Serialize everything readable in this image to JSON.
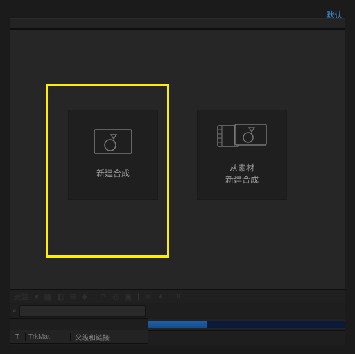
{
  "top": {
    "link_label": "默认"
  },
  "panel": {
    "tiles": [
      {
        "label": "新建合成",
        "icon": "composition-icon"
      },
      {
        "label": "从素材\n新建合成",
        "icon": "media-composition-icon"
      }
    ]
  },
  "toolbar": {
    "quality_label": "完整",
    "percent": "~00"
  },
  "timeline": {
    "col_t": "T",
    "col_trkmat": "TrkMat",
    "col_parent": "父级和链接"
  },
  "colors": {
    "highlight": "#ffee00"
  }
}
